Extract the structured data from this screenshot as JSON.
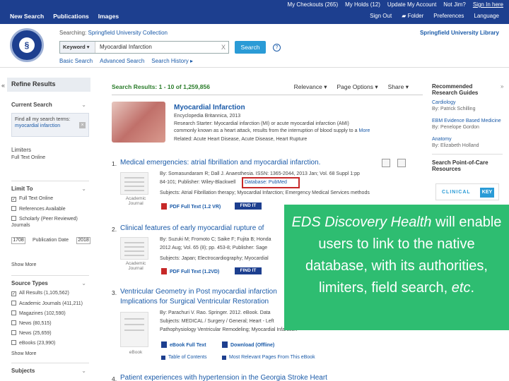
{
  "topbar": {
    "row1": [
      "My Checkouts (265)",
      "My Holds (12)",
      "Update My Account",
      "Not Jim?",
      "Sign In here"
    ],
    "nav_left": [
      "New Search",
      "Publications",
      "Images"
    ],
    "nav_right": [
      "Sign Out",
      "Folder",
      "Preferences",
      "Language"
    ]
  },
  "search": {
    "searching_prefix": "Searching:",
    "collection": "Springfield University Collection",
    "keyword_label": "Keyword",
    "value": "Myocardial Infarction",
    "clear": "X",
    "button": "Search",
    "help": "?",
    "links": [
      "Basic Search",
      "Advanced Search",
      "Search History"
    ],
    "library_name": "Springfield University Library"
  },
  "left": {
    "refine": "Refine Results",
    "current_search": "Current Search",
    "find_all_text": "Find all my search terms:",
    "find_all_term": "myocardial infarction",
    "limiters": "Limiters",
    "limiter_full_text": "Full Text Online",
    "limit_to": "Limit To",
    "limit_items": [
      "Full Text Online",
      "References Available",
      "Scholarly (Peer Reviewed) Journals"
    ],
    "year_from": "1708",
    "year_label": "Publication Date",
    "year_to": "2018",
    "show_more": "Show More",
    "source_types": "Source Types",
    "source_items": [
      "All Results (1,105,562)",
      "Academic Journals (411,211)",
      "Magazines (102,590)",
      "News (80,515)",
      "News (25,659)",
      "eBooks (23,990)"
    ],
    "show_more2": "Show More",
    "subjects": "Subjects"
  },
  "results": {
    "title_prefix": "Search Results:",
    "range": "1 - 10 of 1,259,856",
    "controls": [
      "Relevance",
      "Page Options",
      "Share"
    ]
  },
  "starter": {
    "title": "Myocardial Infarction",
    "source": "Encyclopedia Britannica, 2013",
    "line1": "Research Starter: Myocardial infarction (MI) or acute myocardial infarction (AMI)",
    "line2": "commonly known as a heart attack, results from the interruption of blood supply to a",
    "more": "More",
    "related": "Related: Acute Heart Disease, Acute Disease, Heart Rupture"
  },
  "records": [
    {
      "num": "1.",
      "title": "Medical emergencies: atrial fibrillation and myocardial infarction.",
      "byline": "By: Somasundaram R; Dall J. Anaesthesia. ISSN: 1365-2044, 2013 Jan; Vol. 68 Suppl 1:pp",
      "line2": "84-101; Publisher: Wiley-Blackwell",
      "database": "Database: PubMed",
      "subjects": "Subjects: Atrial Fibrillation therapy; Myocardial Infarction; Emergency Medical Services methods",
      "type": "Academic Journal",
      "pdf": "PDF Full Text (1.2 VR)",
      "findit": "FIND IT"
    },
    {
      "num": "2.",
      "title": "Clinical features of early myocardial rupture of",
      "byline": "By: Suzuki M; Fromoto C; Saike F; Fujita B; Honda",
      "line2": "2012 Aug; Vol. 65 (8); pp. 453-8; Publisher: Sage",
      "subjects": "Subjects: Japan; Electrocardiography; Myocardial",
      "type": "Academic Journal",
      "pdf": "PDF Full Text (1.2VD)",
      "findit": "FIND IT"
    },
    {
      "num": "3.",
      "title": "Ventricular Geometry in Post myocardial infarction",
      "title2": "Implications for Surgical Ventricular Restoration",
      "byline": "By: Parachuri V. Rao. Springer. 2012. eBook. Data",
      "line2": "Subjects: MEDICAL / Surgery / General; Heart - Left",
      "line3": "Pathophysiology Ventricular Remodeling; Myocardial Infarction",
      "type": "eBook",
      "ebook": "eBook Full Text",
      "download": "Download (Offline)",
      "toc": "Table of Contents",
      "most": "Most Relevant Pages From This eBook"
    },
    {
      "num": "4.",
      "title": "Patient experiences with hypertension in the Georgia Stroke Heart"
    }
  ],
  "right": {
    "guides_title": "Recommended Research Guides",
    "guides": [
      {
        "name": "Cardiology",
        "by": "By: Patrick Schilling"
      },
      {
        "name": "EBM Evidence Based Medicine",
        "by": "By: Penelope Gordon"
      },
      {
        "name": "Anatomy",
        "by": "By: Elizabeth Holland"
      }
    ],
    "poc_title": "Search Point-of-Care Resources",
    "clinicalkey": "CLINICAL",
    "clinicalkey_k": "KEY"
  },
  "callout": {
    "part1": "EDS Discovery Health",
    "part2": " will enable users to link to the native database, with its authorities, limiters, field search, ",
    "part3": "etc",
    "part4": "."
  },
  "colors": {
    "brand": "#1d3f8f",
    "link": "#1a5aa8",
    "callout": "#2ebd71",
    "highlight_box": "#c62828"
  }
}
